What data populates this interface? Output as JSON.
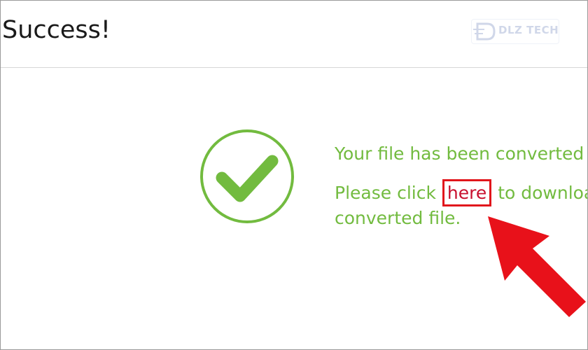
{
  "header": {
    "title": "Success!",
    "watermark_text": "DLZ TECH"
  },
  "message": {
    "line1": "Your file has been converted",
    "line2_before": "Please click",
    "link_label": "here",
    "line2_after": "to download",
    "line3": "converted file."
  },
  "colors": {
    "success_green": "#72bb3f",
    "highlight_red": "#e1161c"
  },
  "icons": {
    "status": "check-circle-icon",
    "annotation": "arrow-pointer-icon"
  }
}
